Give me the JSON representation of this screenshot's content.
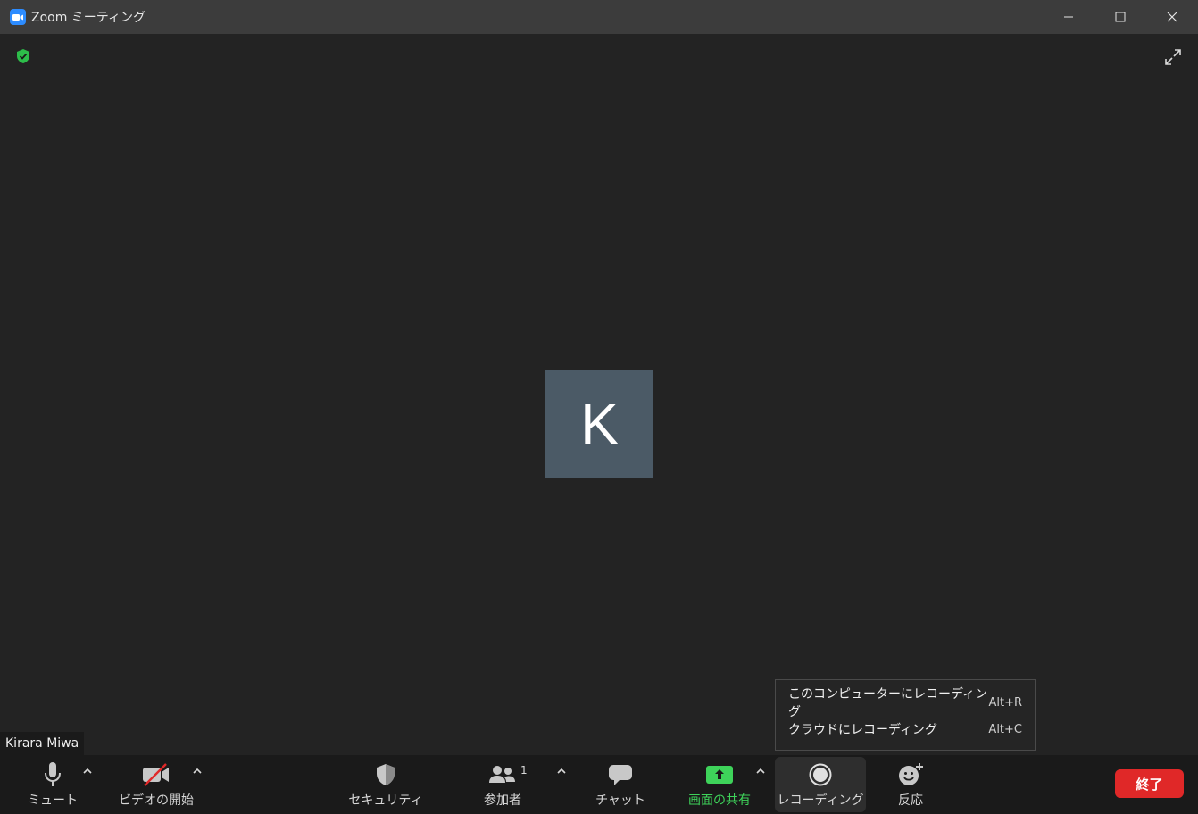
{
  "window": {
    "title": "Zoom ミーティング"
  },
  "video": {
    "avatar_initial": "K",
    "participant_name": "Kirara Miwa"
  },
  "record_menu": {
    "items": [
      {
        "label": "このコンピューターにレコーディング",
        "shortcut": "Alt+R"
      },
      {
        "label": "クラウドにレコーディング",
        "shortcut": "Alt+C"
      }
    ]
  },
  "toolbar": {
    "mute": "ミュート",
    "video": "ビデオの開始",
    "security": "セキュリティ",
    "participants": "参加者",
    "participants_count": "1",
    "chat": "チャット",
    "share": "画面の共有",
    "record": "レコーディング",
    "reactions": "反応",
    "end": "終了"
  },
  "colors": {
    "share_green": "#3ed35a",
    "end_red": "#e02828",
    "zoom_blue": "#2d8cff"
  }
}
